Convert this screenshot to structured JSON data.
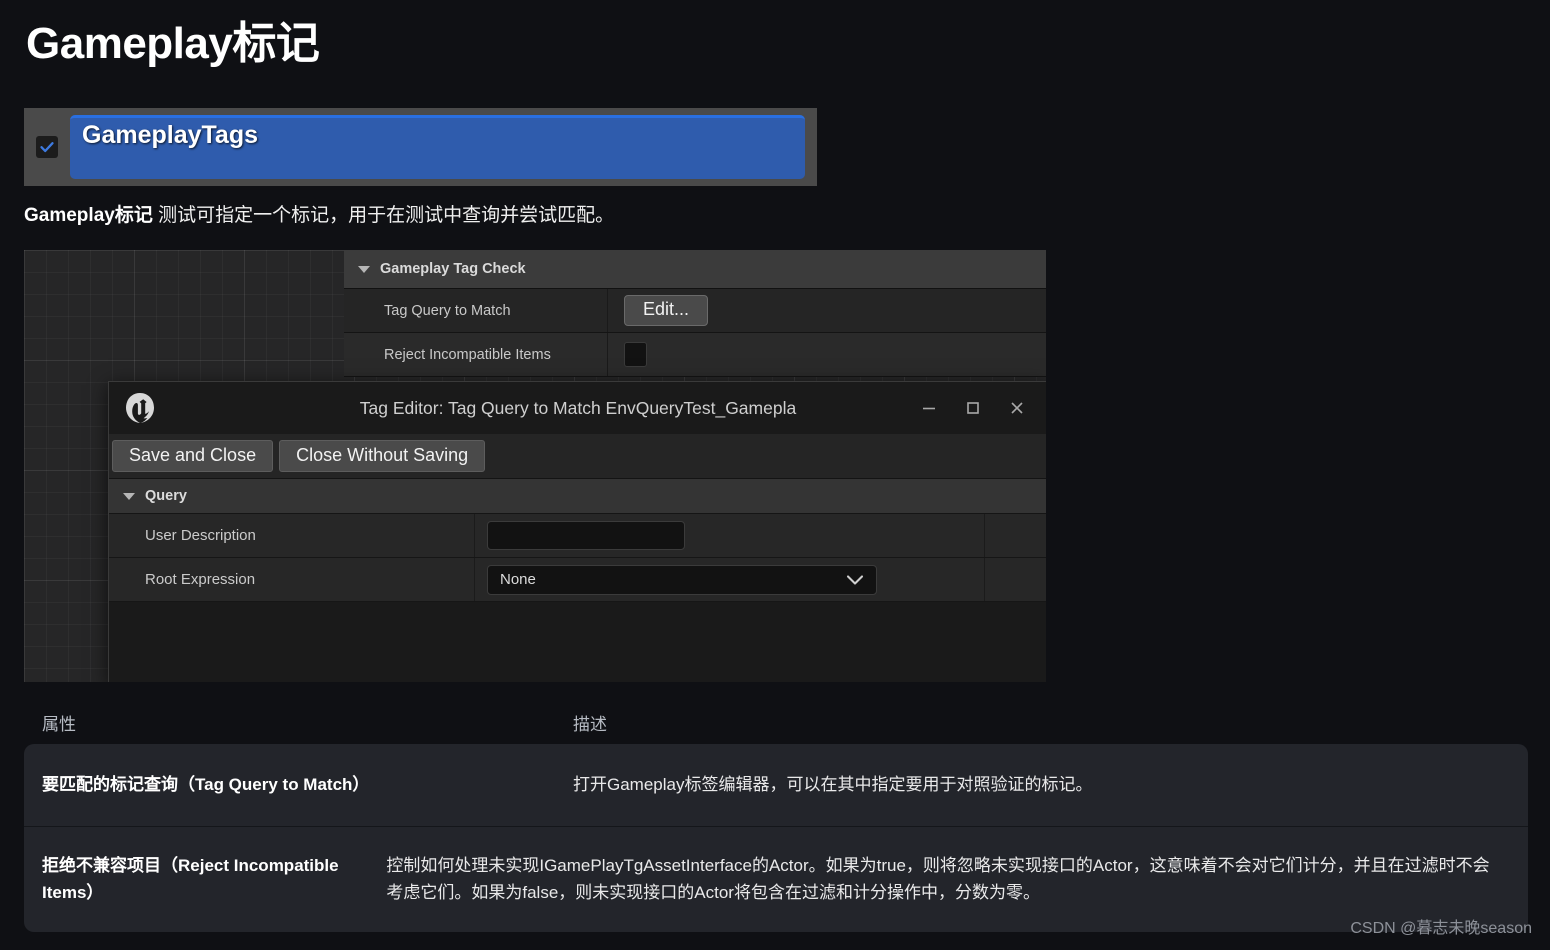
{
  "page": {
    "title": "Gameplay标记",
    "subtitle_bold": "Gameplay标记",
    "subtitle_rest": " 测试可指定一个标记，用于在测试中查询并尝试匹配。",
    "watermark": "CSDN @暮志未晚season",
    "background_color": "#0f1014"
  },
  "tag_banner": {
    "label": "GameplayTags",
    "checked": true,
    "accent_color": "#2f5cad",
    "top_edge_color": "#2a6fe0",
    "frame_color": "#4a4a4a"
  },
  "details_panel": {
    "section_title": "Gameplay Tag Check",
    "rows": [
      {
        "label": "Tag Query to Match",
        "control": "button",
        "value": "Edit..."
      },
      {
        "label": "Reject Incompatible Items",
        "control": "checkbox",
        "value": ""
      }
    ]
  },
  "tag_editor": {
    "window_title": "Tag Editor: Tag Query to Match EnvQueryTest_Gamepla",
    "logo": "unreal-engine-logo",
    "window_buttons": {
      "minimize": "−",
      "maximize": "▢",
      "close": "✕"
    },
    "toolbar": {
      "save_and_close": "Save and Close",
      "close_without_saving": "Close Without Saving"
    },
    "query_section_title": "Query",
    "rows": [
      {
        "label": "User Description",
        "control": "text",
        "value": ""
      },
      {
        "label": "Root Expression",
        "control": "dropdown",
        "value": "None"
      }
    ]
  },
  "doc_table": {
    "headers": [
      "属性",
      "描述"
    ],
    "rows": [
      {
        "property": "要匹配的标记查询（Tag Query to Match）",
        "description": "打开Gameplay标签编辑器，可以在其中指定要用于对照验证的标记。"
      },
      {
        "property": "拒绝不兼容项目（Reject Incompatible Items）",
        "description": "控制如何处理未实现IGamePlayTgAssetInterface的Actor。如果为true，则将忽略未实现接口的Actor，这意味着不会对它们计分，并且在过滤时不会考虑它们。如果为false，则未实现接口的Actor将包含在过滤和计分操作中，分数为零。"
      }
    ]
  }
}
